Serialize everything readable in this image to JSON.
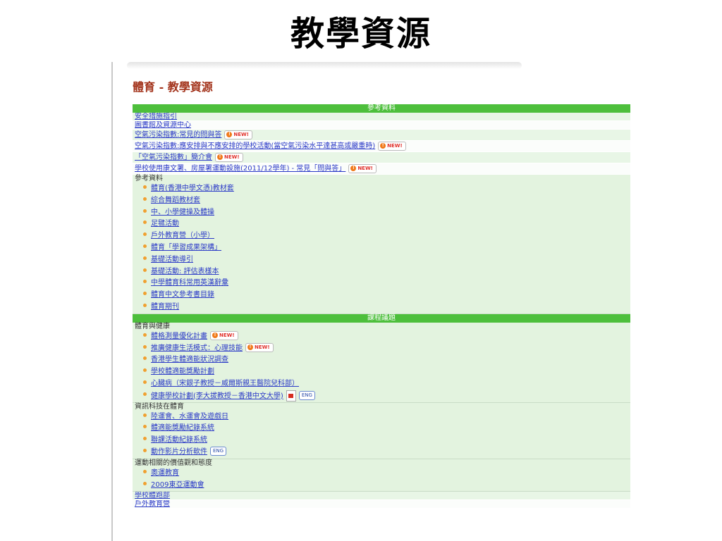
{
  "slide_title": "教學資源",
  "page_heading": "體育 - 教學資源",
  "sections": {
    "reference_bar": "參考資料",
    "curriculum_bar": "課程議題"
  },
  "top_links": [
    {
      "text": "安全措施指引"
    },
    {
      "text": "圖書館及資源中心"
    },
    {
      "text": "空氣污染指數:常見的問與答",
      "badge": "NEW!"
    },
    {
      "text": "空氣污染指數:應安排與不應安排的學校活動(當空氣污染水平達甚高或嚴重時)",
      "badge": "NEW!"
    },
    {
      "text": "「空氣污染指數」簡介會",
      "badge": "NEW!"
    },
    {
      "text": "學校使用康文署、房屋署運動設施(2011/12學年) - 常見「問與答」",
      "badge": "NEW!"
    }
  ],
  "reference_group": {
    "title": "參考資料",
    "items": [
      "體育(香港中學文憑)教材套",
      "綜合舞蹈教材套",
      "中、小學健操及體操",
      "足毽活動",
      "戶外教育營（小學）",
      "體育「學習成果架構」",
      "基礎活動導引",
      "基礎活動: 評估表樣本",
      "中學體育科常用英漢辭彙",
      "體育中文參考書目錄",
      "體育期刊"
    ]
  },
  "health_group": {
    "title": "體育與健康",
    "items": [
      {
        "text": "體格測量優化計畫",
        "badge": "NEW!"
      },
      {
        "text": "推廣健康生活模式：心理技能",
        "badge": "NEW!"
      },
      {
        "text": "香港學生體適能狀況調查"
      },
      {
        "text": "學校體適能獎勵計劃"
      },
      {
        "text": "心臟病（宋銀子教授－威爾斯親王醫院兒科部）"
      },
      {
        "text": "健康學校計劃(李大拔教授－香港中文大學)",
        "pdf": "pdf-icon",
        "eng": "ENG"
      }
    ]
  },
  "it_group": {
    "title": "資訊科技在體育",
    "items": [
      {
        "text": "陸運會、水運會及遊戲日"
      },
      {
        "text": "體適能獎勵紀錄系統"
      },
      {
        "text": "聯課活動紀錄系統"
      },
      {
        "text": "動作影片分析軟件",
        "eng": "ENG"
      }
    ]
  },
  "values_group": {
    "title": "運動相關的價值觀和態度",
    "items": [
      "奧運教育",
      "2009東亞運動會"
    ]
  },
  "bottom_links": [
    "學校體跑部",
    "戶外教育營"
  ]
}
